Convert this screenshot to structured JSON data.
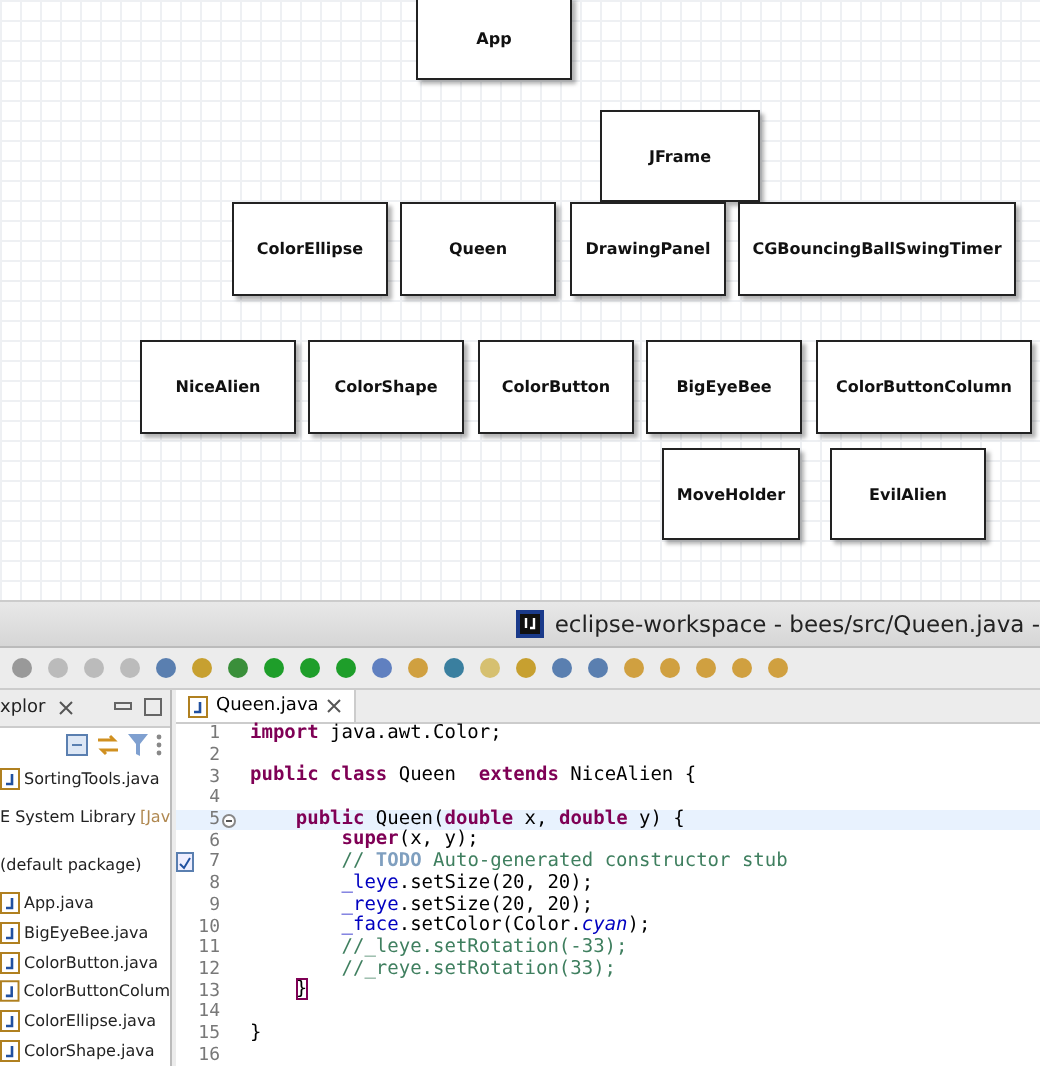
{
  "diagram": {
    "nodes": [
      {
        "label": "App"
      },
      {
        "label": "JFrame"
      },
      {
        "label": "ColorEllipse"
      },
      {
        "label": "Queen"
      },
      {
        "label": "DrawingPanel"
      },
      {
        "label": "CGBouncingBallSwingTimer"
      },
      {
        "label": "NiceAlien"
      },
      {
        "label": "ColorShape"
      },
      {
        "label": "ColorButton"
      },
      {
        "label": "BigEyeBee"
      },
      {
        "label": "ColorButtonColumn"
      },
      {
        "label": "MoveHolder"
      },
      {
        "label": "EvilAlien"
      }
    ]
  },
  "window": {
    "title": "eclipse-workspace - bees/src/Queen.java -"
  },
  "explorer": {
    "tab": "xplor",
    "items": [
      {
        "label": "SortingTools.java",
        "kind": "file"
      },
      {
        "label": "E System Library",
        "suffix": "[Jav",
        "kind": "library"
      },
      {
        "label": "(default package)",
        "kind": "package"
      },
      {
        "label": "App.java",
        "kind": "file"
      },
      {
        "label": "BigEyeBee.java",
        "kind": "file"
      },
      {
        "label": "ColorButton.java",
        "kind": "file"
      },
      {
        "label": "ColorButtonColum",
        "kind": "file"
      },
      {
        "label": "ColorEllipse.java",
        "kind": "file"
      },
      {
        "label": "ColorShape.java",
        "kind": "file"
      }
    ]
  },
  "editor": {
    "tab": "Queen.java",
    "lines": [
      {
        "n": "1",
        "current": false,
        "kind": "plain",
        "segs": [
          {
            "t": "import",
            "kind": "keyword"
          },
          {
            "t": " java.awt.Color;",
            "kind": "plain"
          }
        ]
      },
      {
        "n": "2",
        "current": false,
        "kind": "plain"
      },
      {
        "n": "3",
        "current": false,
        "kind": "plain",
        "segs": [
          {
            "t": "public class",
            "kind": "keyword"
          },
          {
            "t": " Queen  ",
            "kind": "plain"
          },
          {
            "t": "extends",
            "kind": "keyword"
          },
          {
            "t": " NiceAlien {",
            "kind": "plain"
          }
        ]
      },
      {
        "n": "4",
        "current": false,
        "kind": "plain"
      },
      {
        "n": "5",
        "current": true,
        "kind": "fold",
        "segs": [
          {
            "t": "    public",
            "kind": "keyword"
          },
          {
            "t": " Queen(",
            "kind": "plain"
          },
          {
            "t": "double",
            "kind": "keyword"
          },
          {
            "t": " x, ",
            "kind": "plain"
          },
          {
            "t": "double",
            "kind": "keyword"
          },
          {
            "t": " y) {",
            "kind": "plain"
          }
        ]
      },
      {
        "n": "6",
        "current": false,
        "kind": "plain",
        "segs": [
          {
            "t": "        super",
            "kind": "keyword"
          },
          {
            "t": "(x, y);",
            "kind": "plain"
          }
        ]
      },
      {
        "n": "7",
        "current": false,
        "kind": "task",
        "segs": [
          {
            "t": "        // ",
            "kind": "comment"
          },
          {
            "t": "TODO",
            "kind": "todo"
          },
          {
            "t": " Auto-generated constructor stub",
            "kind": "comment"
          }
        ]
      },
      {
        "n": "8",
        "current": false,
        "kind": "plain",
        "segs": [
          {
            "t": "        _leye",
            "kind": "field"
          },
          {
            "t": ".setSize(20, 20);",
            "kind": "plain"
          }
        ]
      },
      {
        "n": "9",
        "current": false,
        "kind": "plain",
        "segs": [
          {
            "t": "        _reye",
            "kind": "field"
          },
          {
            "t": ".setSize(20, 20);",
            "kind": "plain"
          }
        ]
      },
      {
        "n": "10",
        "current": false,
        "kind": "plain",
        "segs": [
          {
            "t": "        _face",
            "kind": "field"
          },
          {
            "t": ".setColor(Color.",
            "kind": "plain"
          },
          {
            "t": "cyan",
            "kind": "static"
          },
          {
            "t": ");",
            "kind": "plain"
          }
        ]
      },
      {
        "n": "11",
        "current": false,
        "kind": "plain",
        "segs": [
          {
            "t": "        //_leye.setRotation(-33);",
            "kind": "comment"
          }
        ]
      },
      {
        "n": "12",
        "current": false,
        "kind": "plain",
        "segs": [
          {
            "t": "        //_reye.setRotation(33);",
            "kind": "comment"
          }
        ]
      },
      {
        "n": "13",
        "current": false,
        "kind": "plain",
        "segs": [
          {
            "t": "    }",
            "kind": "bracket"
          }
        ]
      },
      {
        "n": "14",
        "current": false,
        "kind": "plain"
      },
      {
        "n": "15",
        "current": false,
        "kind": "plain",
        "segs": [
          {
            "t": "}",
            "kind": "plain"
          }
        ]
      },
      {
        "n": "16",
        "current": false,
        "kind": "plain"
      }
    ]
  }
}
